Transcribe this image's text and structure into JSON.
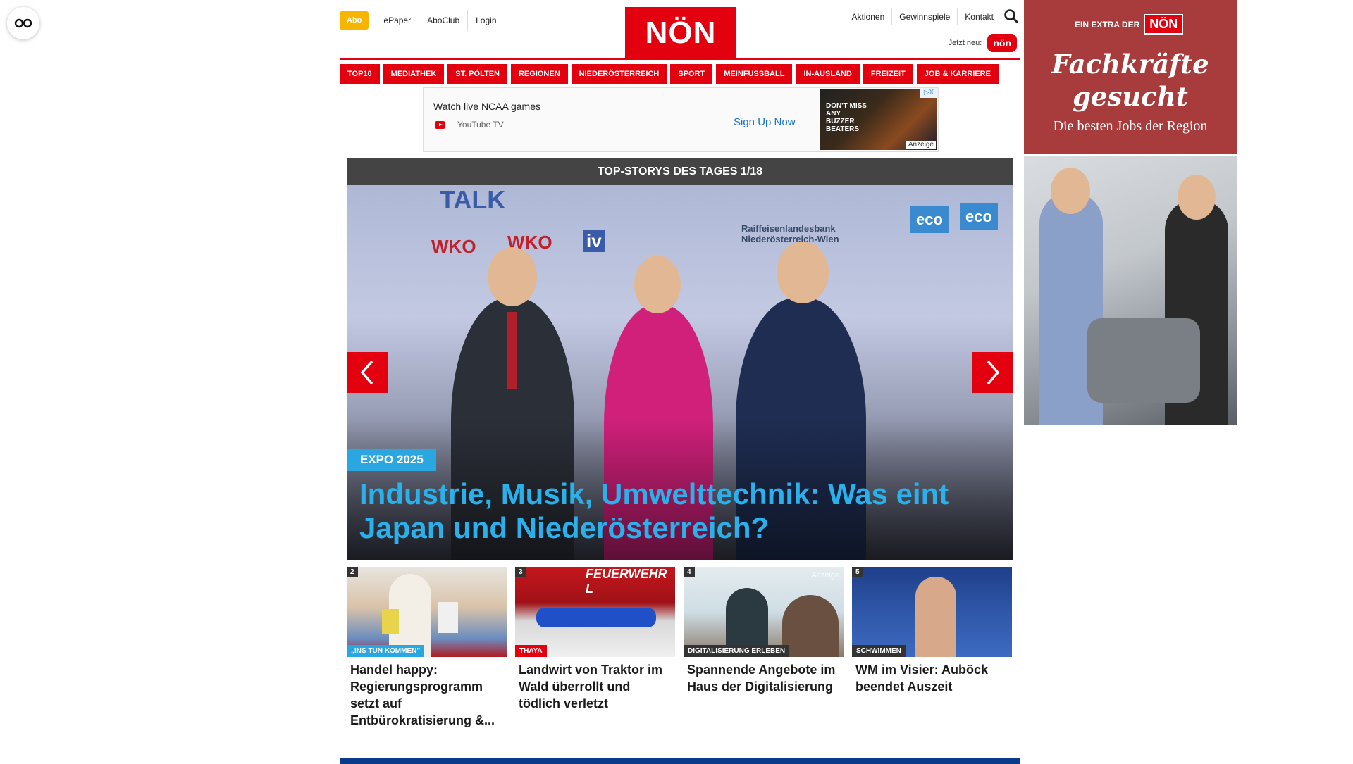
{
  "reader_icon": "glasses-icon",
  "top_nav": {
    "abo": "Abo",
    "links": [
      "ePaper",
      "AboClub",
      "Login"
    ]
  },
  "logo": "NÖN",
  "right_nav": {
    "links": [
      "Aktionen",
      "Gewinnspiele",
      "Kontakt"
    ],
    "search_icon": "search-icon",
    "jetzt_label": "Jetzt neu:",
    "jetzt_badge": "nön"
  },
  "categories": [
    "TOP10",
    "MEDIATHEK",
    "ST. PÖLTEN",
    "REGIONEN",
    "NIEDERÖSTERREICH",
    "SPORT",
    "MEINFUSSBALL",
    "IN-AUSLAND",
    "FREIZEIT",
    "JOB & KARRIERE"
  ],
  "ad_banner": {
    "title": "Watch live NCAA games",
    "source": "YouTube TV",
    "cta": "Sign Up Now",
    "thumb_text": "DON'T MISS ANY BUZZER BEATERS",
    "thumb_label": "Anzeige",
    "close": "▷X"
  },
  "slider": {
    "header": "TOP-STORYS DES TAGES 1/18",
    "tag": "EXPO 2025",
    "headline": "Industrie, Musik, Umwelttechnik: Was eint Japan und Niederösterreich?",
    "screen_texts": [
      "TALK",
      "WKO",
      "WKO",
      "iv",
      "Raiffeisenlandesbank Niederösterreich-Wien",
      "eco",
      "eco"
    ],
    "prev_icon": "chevron-left-icon",
    "next_icon": "chevron-right-icon"
  },
  "cards": [
    {
      "num": "2",
      "tag": "„INS TUN KOMMEN\"",
      "tag_color": "#2aa7e0",
      "title": "Handel happy: Regierungsprogramm setzt auf Entbürokratisierung &..."
    },
    {
      "num": "3",
      "tag": "THAYA",
      "tag_color": "#e3000f",
      "title": "Landwirt von Traktor im Wald überrollt und tödlich verletzt",
      "img_text": "FEUERWEHR L"
    },
    {
      "num": "4",
      "tag": "DIGITALISIERUNG ERLEBEN",
      "tag_color": "#333333",
      "title": "Spannende Angebote im Haus der Digitalisierung",
      "img_label": "Anzeige"
    },
    {
      "num": "5",
      "tag": "SCHWIMMEN",
      "tag_color": "#333333",
      "title": "WM im Visier: Auböck beendet Auszeit"
    }
  ],
  "side_ad": {
    "extra_label": "EIN EXTRA DER",
    "extra_logo": "NÖN",
    "headline": "Fachkräfte gesucht",
    "subline": "Die besten Jobs der Region"
  },
  "colors": {
    "brand_red": "#e3000f",
    "abo_yellow": "#f7b500",
    "headline_blue": "#2ab0ea"
  }
}
